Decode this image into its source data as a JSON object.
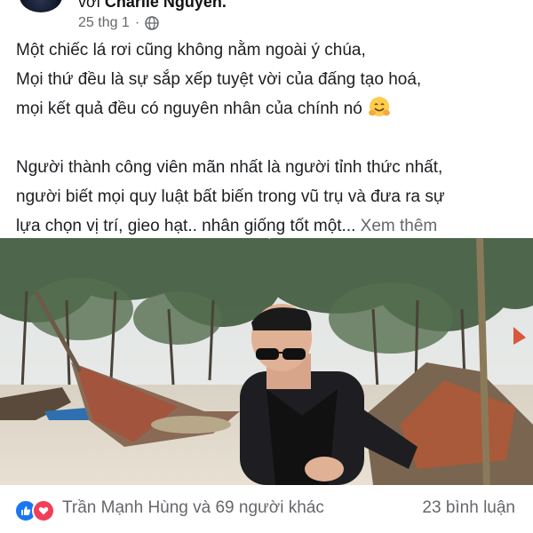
{
  "header": {
    "with_word": "với",
    "tagged_name": "Charlie Nguyễn.",
    "timestamp": "25 thg 1",
    "separator": "·",
    "privacy_icon": "globe-icon"
  },
  "post": {
    "lines": [
      "Một chiếc lá rơi cũng không nằm ngoài ý chúa,",
      "Mọi thứ đều là sự sắp xếp tuyệt vời của đấng tạo hoá,",
      "mọi kết quả đều có nguyên nhân của chính nó",
      "Người thành công viên mãn nhất là người tỉnh thức nhất,",
      "người biết mọi quy luật bất biến trong vũ trụ và đưa ra sự",
      "lựa chọn vị trí, gieo hạt.. nhân giống tốt một..."
    ],
    "see_more": "Xem thêm",
    "emoji": "hugging-face-emoji"
  },
  "footer": {
    "reaction_icons": [
      "like-icon",
      "love-icon"
    ],
    "reactors_text": "Trần Mạnh Hùng và 69 người khác",
    "comments_text": "23 bình luận"
  },
  "colors": {
    "secondary_text": "#65676b",
    "like_blue": "#1877f2",
    "love_red": "#f33e58"
  }
}
